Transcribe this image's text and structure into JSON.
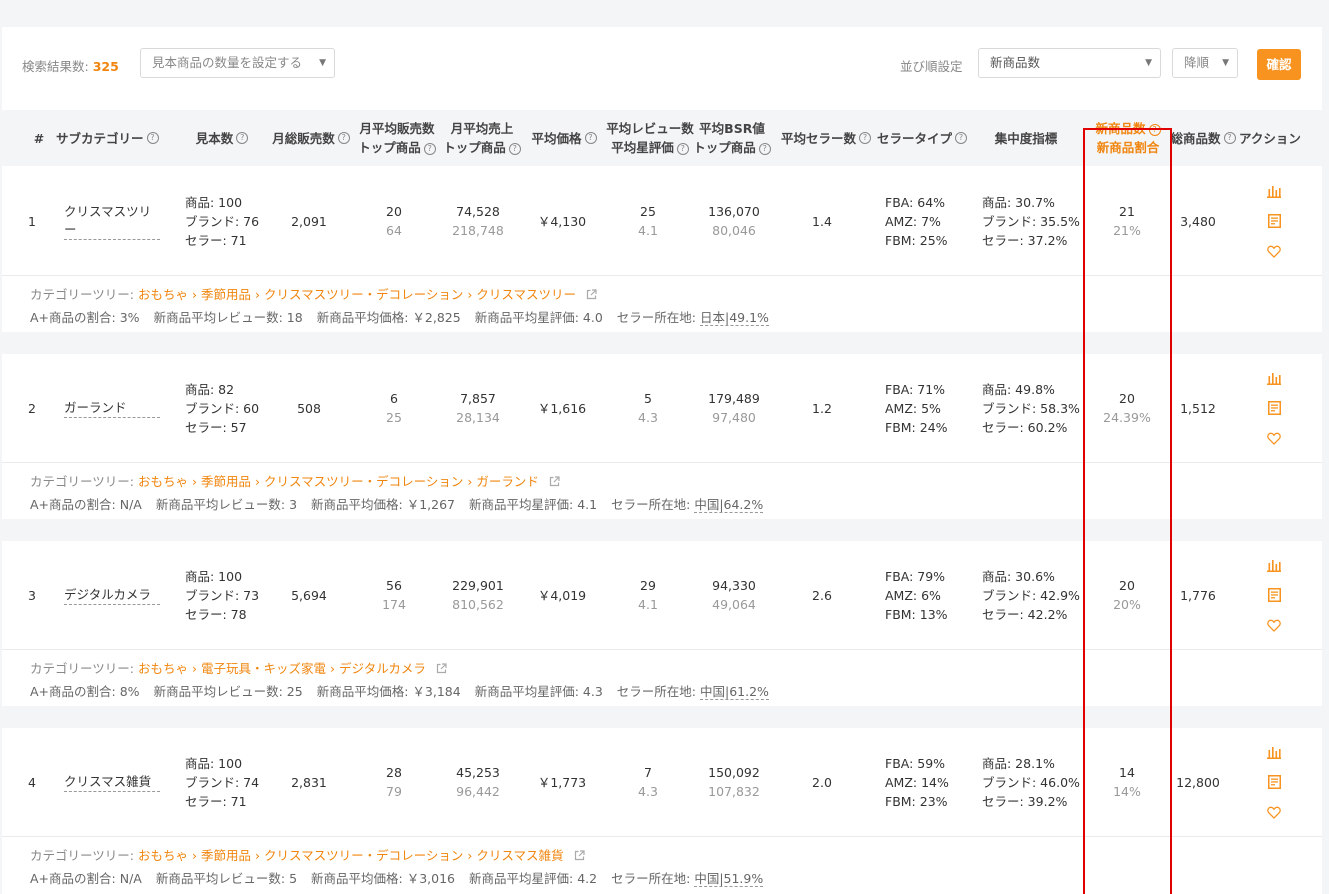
{
  "toolbar": {
    "result_count_label": "検索結果数:",
    "result_count": "325",
    "sample_select_placeholder": "見本商品の数量を設定する",
    "sort_label": "並び順設定",
    "sort_field": "新商品数",
    "sort_order": "降順",
    "confirm": "確認"
  },
  "columns": {
    "index": "#",
    "subcategory": "サブカテゴリー",
    "sample": "見本数",
    "monthly_sales": "月総販売数",
    "avg_sales_l1": "月平均販売数",
    "avg_sales_l2": "トップ商品",
    "avg_revenue_l1": "月平均売上",
    "avg_revenue_l2": "トップ商品",
    "avg_price": "平均価格",
    "review_l1": "平均レビュー数",
    "review_l2": "平均星評価",
    "bsr_l1": "平均BSR値",
    "bsr_l2": "トップ商品",
    "sellers": "平均セラー数",
    "seller_type": "セラータイプ",
    "concentration": "集中度指標",
    "new_l1": "新商品数",
    "new_l2": "新商品割合",
    "total": "総商品数",
    "action": "アクション"
  },
  "labels": {
    "tree": "カテゴリーツリー:",
    "aplus": "A+商品の割合:",
    "new_reviews": "新商品平均レビュー数:",
    "new_price": "新商品平均価格:",
    "new_rating": "新商品平均星評価:",
    "seller_loc": "セラー所在地:"
  },
  "rows": [
    {
      "idx": "1",
      "name": "クリスマスツリー",
      "sample_products": "商品: 100",
      "sample_brands": "ブランド: 76",
      "sample_sellers": "セラー: 71",
      "monthly_sales": "2,091",
      "avg_sales": "20",
      "avg_sales_top": "64",
      "avg_revenue": "74,528",
      "avg_revenue_top": "218,748",
      "avg_price": "￥4,130",
      "reviews": "25",
      "rating": "4.1",
      "bsr": "136,070",
      "bsr_top": "80,046",
      "sellers": "1.4",
      "fba": "FBA: 64%",
      "amz": "AMZ: 7%",
      "fbm": "FBM: 25%",
      "conc_products": "商品: 30.7%",
      "conc_brands": "ブランド: 35.5%",
      "conc_sellers": "セラー: 37.2%",
      "new_count": "21",
      "new_ratio": "21%",
      "total": "3,480",
      "tree": [
        "おもちゃ",
        "季節用品",
        "クリスマスツリー・デコレーション",
        "クリスマスツリー"
      ],
      "aplus": "3%",
      "new_reviews": "18",
      "new_price": "￥2,825",
      "new_rating": "4.0",
      "seller_loc": "日本|49.1%"
    },
    {
      "idx": "2",
      "name": "ガーランド",
      "sample_products": "商品: 82",
      "sample_brands": "ブランド: 60",
      "sample_sellers": "セラー: 57",
      "monthly_sales": "508",
      "avg_sales": "6",
      "avg_sales_top": "25",
      "avg_revenue": "7,857",
      "avg_revenue_top": "28,134",
      "avg_price": "￥1,616",
      "reviews": "5",
      "rating": "4.3",
      "bsr": "179,489",
      "bsr_top": "97,480",
      "sellers": "1.2",
      "fba": "FBA: 71%",
      "amz": "AMZ: 5%",
      "fbm": "FBM: 24%",
      "conc_products": "商品: 49.8%",
      "conc_brands": "ブランド: 58.3%",
      "conc_sellers": "セラー: 60.2%",
      "new_count": "20",
      "new_ratio": "24.39%",
      "total": "1,512",
      "tree": [
        "おもちゃ",
        "季節用品",
        "クリスマスツリー・デコレーション",
        "ガーランド"
      ],
      "aplus": "N/A",
      "new_reviews": "3",
      "new_price": "￥1,267",
      "new_rating": "4.1",
      "seller_loc": "中国|64.2%"
    },
    {
      "idx": "3",
      "name": "デジタルカメラ",
      "sample_products": "商品: 100",
      "sample_brands": "ブランド: 73",
      "sample_sellers": "セラー: 78",
      "monthly_sales": "5,694",
      "avg_sales": "56",
      "avg_sales_top": "174",
      "avg_revenue": "229,901",
      "avg_revenue_top": "810,562",
      "avg_price": "￥4,019",
      "reviews": "29",
      "rating": "4.1",
      "bsr": "94,330",
      "bsr_top": "49,064",
      "sellers": "2.6",
      "fba": "FBA: 79%",
      "amz": "AMZ: 6%",
      "fbm": "FBM: 13%",
      "conc_products": "商品: 30.6%",
      "conc_brands": "ブランド: 42.9%",
      "conc_sellers": "セラー: 42.2%",
      "new_count": "20",
      "new_ratio": "20%",
      "total": "1,776",
      "tree": [
        "おもちゃ",
        "電子玩具・キッズ家電",
        "デジタルカメラ"
      ],
      "aplus": "8%",
      "new_reviews": "25",
      "new_price": "￥3,184",
      "new_rating": "4.3",
      "seller_loc": "中国|61.2%"
    },
    {
      "idx": "4",
      "name": "クリスマス雑貨",
      "sample_products": "商品: 100",
      "sample_brands": "ブランド: 74",
      "sample_sellers": "セラー: 71",
      "monthly_sales": "2,831",
      "avg_sales": "28",
      "avg_sales_top": "79",
      "avg_revenue": "45,253",
      "avg_revenue_top": "96,442",
      "avg_price": "￥1,773",
      "reviews": "7",
      "rating": "4.3",
      "bsr": "150,092",
      "bsr_top": "107,832",
      "sellers": "2.0",
      "fba": "FBA: 59%",
      "amz": "AMZ: 14%",
      "fbm": "FBM: 23%",
      "conc_products": "商品: 28.1%",
      "conc_brands": "ブランド: 46.0%",
      "conc_sellers": "セラー: 39.2%",
      "new_count": "14",
      "new_ratio": "14%",
      "total": "12,800",
      "tree": [
        "おもちゃ",
        "季節用品",
        "クリスマスツリー・デコレーション",
        "クリスマス雑貨"
      ],
      "aplus": "N/A",
      "new_reviews": "5",
      "new_price": "￥3,016",
      "new_rating": "4.2",
      "seller_loc": "中国|51.9%"
    }
  ],
  "icons": {
    "chart": "bar-chart-icon",
    "detail": "document-icon",
    "favorite": "heart-icon"
  },
  "colors": {
    "accent": "#f7931e",
    "highlight": "#e00000"
  }
}
